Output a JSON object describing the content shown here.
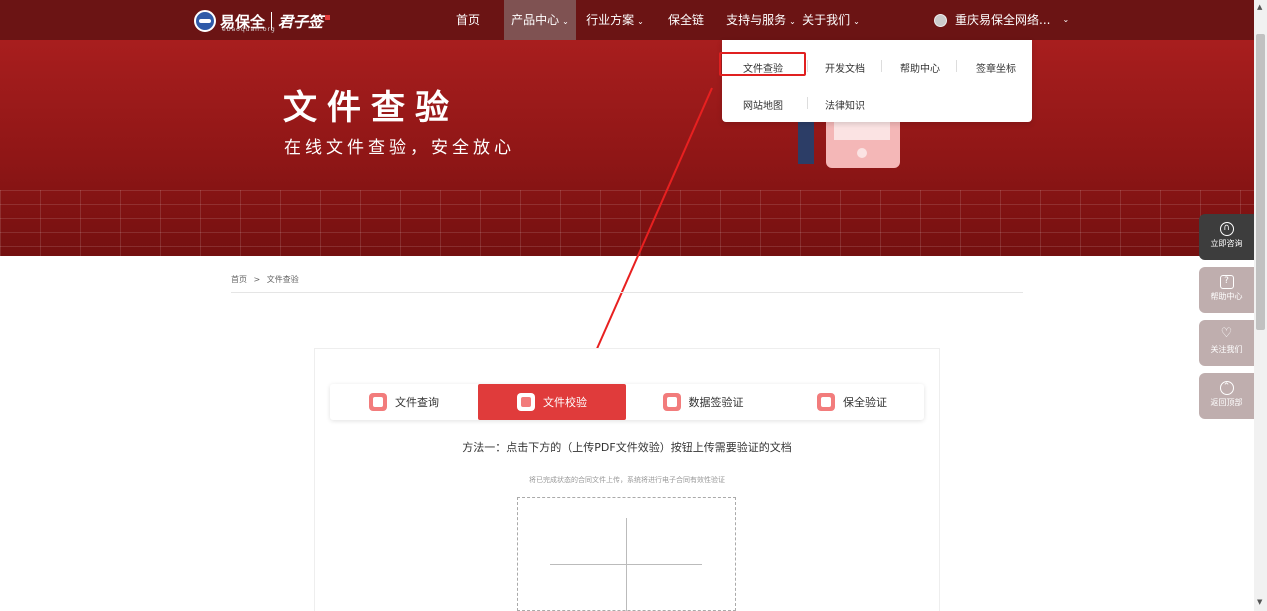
{
  "nav": {
    "logo_text": "易保全",
    "logo_sub": "ebaoquan.org",
    "logo_text2": "君子签",
    "items": [
      {
        "label": "首页"
      },
      {
        "label": "产品中心",
        "caret": "⌄"
      },
      {
        "label": "行业方案",
        "caret": "⌄"
      },
      {
        "label": "保全链"
      },
      {
        "label": "支持与服务",
        "caret": "⌄"
      },
      {
        "label": "关于我们",
        "caret": "⌄"
      }
    ],
    "user": "重庆易保全网络...",
    "user_caret": "⌄"
  },
  "banner": {
    "title": "文件查验",
    "subtitle": "在线文件查验，安全放心"
  },
  "dropdown": {
    "items": [
      "文件查验",
      "开发文档",
      "帮助中心",
      "签章坐标",
      "网站地图",
      "法律知识"
    ]
  },
  "side_buttons": [
    {
      "label": "立即咨询",
      "icon": "headset-icon"
    },
    {
      "label": "帮助中心",
      "icon": "help-icon"
    },
    {
      "label": "关注我们",
      "icon": "heart-icon"
    },
    {
      "label": "返回顶部",
      "icon": "top-icon"
    }
  ],
  "breadcrumb": {
    "home": "首页",
    "sep": ">",
    "current": "文件查验"
  },
  "tabs": [
    {
      "label": "文件查询"
    },
    {
      "label": "文件校验"
    },
    {
      "label": "数据签验证"
    },
    {
      "label": "保全验证"
    }
  ],
  "method_text": "方法一：点击下方的（上传PDF文件效验）按钮上传需要验证的文档",
  "hint_text": "将已完成状态的合同文件上传，系统将进行电子合同有效性验证",
  "colors": {
    "nav_bg": "#6b1414",
    "accent": "#e03b3b",
    "banner": "#a81e1e"
  }
}
